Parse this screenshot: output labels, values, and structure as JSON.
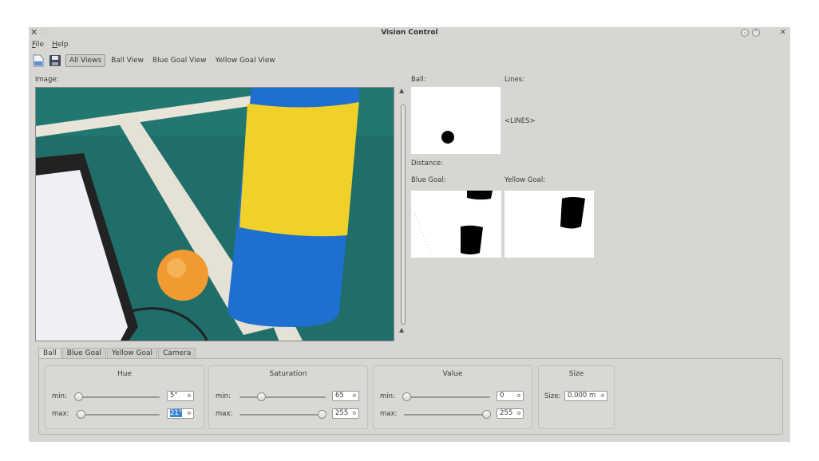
{
  "window": {
    "title": "Vision Control"
  },
  "menu": {
    "file": "File",
    "help": "Help"
  },
  "toolbar": {
    "icons": [
      "document-icon",
      "save-icon"
    ],
    "views": [
      "All Views",
      "Ball View",
      "Blue Goal View",
      "Yellow Goal View"
    ],
    "active_view": "All Views"
  },
  "labels": {
    "image": "Image:",
    "ball": "Ball:",
    "lines": "Lines:",
    "lines_placeholder": "<LINES>",
    "distance": "Distance:",
    "blue_goal": "Blue Goal:",
    "yellow_goal": "Yellow Goal:"
  },
  "tabs": [
    "Ball",
    "Blue Goal",
    "Yellow Goal",
    "Camera"
  ],
  "active_tab": "Ball",
  "controls": {
    "hue": {
      "title": "Hue",
      "min_label": "min:",
      "max_label": "max:",
      "min_value": "5°",
      "max_value": "21°",
      "min_fraction": 0.0,
      "max_fraction": 0.02
    },
    "saturation": {
      "title": "Saturation",
      "min_label": "min:",
      "max_label": "max:",
      "min_value": "65",
      "max_value": "255",
      "min_fraction": 0.25,
      "max_fraction": 1.0
    },
    "value": {
      "title": "Value",
      "min_label": "min:",
      "max_label": "max:",
      "min_value": "0",
      "max_value": "255",
      "min_fraction": 0.0,
      "max_fraction": 1.0
    },
    "size": {
      "title": "Size",
      "size_label": "Size:",
      "size_value": "0.000 m"
    }
  }
}
